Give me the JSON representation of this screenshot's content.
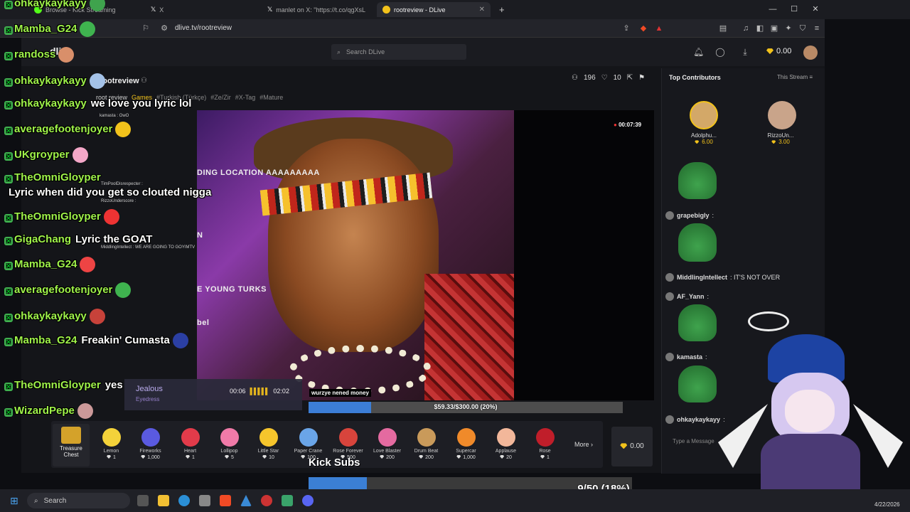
{
  "browser": {
    "tabs": [
      {
        "title": "Browse - Kick Streaming",
        "icon": "kick-icon"
      },
      {
        "title": "X",
        "icon": "x-icon"
      },
      {
        "title": "manlet on X: \"https://t.co/qgXsL",
        "icon": "x-icon"
      },
      {
        "title": "rootreview - DLive",
        "icon": "dlive-icon"
      }
    ],
    "new_tab": "+",
    "url": "dlive.tv/rootreview",
    "window": {
      "minimize": "—",
      "maximize": "☐",
      "close": "✕"
    }
  },
  "dlive": {
    "logo": "dlive",
    "search_placeholder": "Search DLive",
    "balance": "0.00",
    "streamer": "rootreview",
    "stream_title": "root review",
    "category": "Games",
    "tags": [
      "#Turkish (Türkçe)",
      "#Ze/Zir",
      "#X-Tag",
      "#Mature"
    ],
    "viewers": "196",
    "likes": "10",
    "video_timer": "00:07:39",
    "video_overlay": {
      "line1": "DING LOCATION AAAAAAAAA",
      "line2": "N",
      "line3": "E YOUNG TURKS",
      "line4": "bel",
      "mini_chat": [
        "kamasta : OwO",
        "TimPoolDisrespecter :",
        "RizzoUnderscore :",
        "MiddlingIntellect : WE ARE GOING TO GOYIMTV"
      ],
      "bottom_caption": "wurzye nened money"
    },
    "music": {
      "song": "Jealous",
      "artist": "Eyedress",
      "elapsed": "00:06",
      "total": "02:02"
    },
    "donation_progress": "$59.33/$300.00 (20%)",
    "donation_fraction": 0.2,
    "top_contributors_title": "Top Contributors",
    "this_stream": "This Stream",
    "contributors": [
      {
        "name": "Adolphu...",
        "amount": "6.00"
      },
      {
        "name": "RizzoUn...",
        "amount": "3.00"
      }
    ],
    "chat": [
      {
        "user": "grapebigly",
        "text": ":"
      },
      {
        "user": "MiddlingIntellect",
        "text": ": IT'S NOT OVER"
      },
      {
        "user": "AF_Yann",
        "text": ":"
      },
      {
        "user": "kamasta",
        "text": ":"
      },
      {
        "user": "ohkaykaykayy",
        "text": ":"
      }
    ],
    "type_message": "Type a Message",
    "treasure": {
      "line1": "Treasure",
      "line2": "Chest"
    },
    "gifts": [
      {
        "name": "Lemon",
        "price": "1",
        "color": "#f4d23a"
      },
      {
        "name": "Fireworks",
        "price": "1,000",
        "color": "#5a5ae0"
      },
      {
        "name": "Heart",
        "price": "1",
        "color": "#e23b4a"
      },
      {
        "name": "Lollipop",
        "price": "5",
        "color": "#f07aa8"
      },
      {
        "name": "Little Star",
        "price": "10",
        "color": "#f6c52c"
      },
      {
        "name": "Paper Crane",
        "price": "100",
        "color": "#6aa5e8"
      },
      {
        "name": "Rose Forever",
        "price": "500",
        "color": "#d8443c"
      },
      {
        "name": "Love Blaster",
        "price": "200",
        "color": "#e46aa0"
      },
      {
        "name": "Drum Beat",
        "price": "200",
        "color": "#c99a5a"
      },
      {
        "name": "Supercar",
        "price": "1,000",
        "color": "#f08a2a"
      },
      {
        "name": "Applause",
        "price": "20",
        "color": "#f2b79a"
      },
      {
        "name": "Rose",
        "price": "1",
        "color": "#c01e2a"
      }
    ],
    "more": "More",
    "gift_balance": "0.00"
  },
  "overlay_chat": [
    {
      "user": "ohkaykaykayy",
      "text": ""
    },
    {
      "user": "Mamba_G24",
      "text": ""
    },
    {
      "user": "randoss",
      "text": ""
    },
    {
      "user": "ohkaykaykayy",
      "text": ""
    },
    {
      "user": "ohkaykaykayy",
      "text": "we love you lyric lol"
    },
    {
      "user": "averagefootenjoyer",
      "text": ""
    },
    {
      "user": "UKgroyper",
      "text": ""
    },
    {
      "user": "TheOmniGloyper",
      "text": ""
    },
    {
      "user": "",
      "text": "Lyric when did you get so clouted nigga"
    },
    {
      "user": "TheOmniGloyper",
      "text": ""
    },
    {
      "user": "GigaChang",
      "text": "Lyric the GOAT"
    },
    {
      "user": "Mamba_G24",
      "text": ""
    },
    {
      "user": "averagefootenjoyer",
      "text": ""
    },
    {
      "user": "ohkaykaykayy",
      "text": ""
    },
    {
      "user": "Mamba_G24",
      "text": "Freakin' Cumasta"
    },
    {
      "user": "TheOmniGloyper",
      "text": "yes"
    },
    {
      "user": "WizardPepe",
      "text": ""
    }
  ],
  "kick_subs": {
    "label": "Kick Subs",
    "progress": "9/50 (18%)",
    "fraction": 0.18
  },
  "taskbar": {
    "search": "Search",
    "date": "4/22/2026"
  },
  "colors": {
    "accent_green": "#9ff24a",
    "gem_gold": "#f2c21b",
    "progress_blue": "#3c7ed6"
  }
}
